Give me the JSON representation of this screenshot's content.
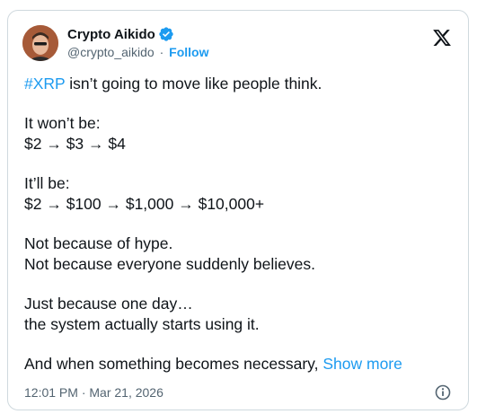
{
  "author": {
    "display_name": "Crypto Aikido",
    "handle": "@crypto_aikido",
    "separator": "·",
    "follow_label": "Follow"
  },
  "colors": {
    "accent": "#1d9bf0",
    "text": "#0f1419",
    "secondary": "#536471",
    "border": "#cfd9de"
  },
  "icons": {
    "verified": "verified-badge-icon",
    "logo": "x-logo-icon",
    "info": "info-icon"
  },
  "tweet": {
    "hashtag": "#XRP",
    "line1_rest": " isn’t going to move like people think.",
    "line2": "It won’t be:",
    "line3": "$2 → $3 → $4",
    "line4": "It’ll be:",
    "line5": "$2 → $100 → $1,000 → $10,000+",
    "line6": "Not because of hype.",
    "line7": "Not because everyone suddenly believes.",
    "line8": "Just because one day…",
    "line9": "the system actually starts using it.",
    "line10": "And when something becomes necessary, ",
    "show_more": "Show more"
  },
  "footer": {
    "timestamp": "12:01 PM · Mar 21, 2026"
  }
}
